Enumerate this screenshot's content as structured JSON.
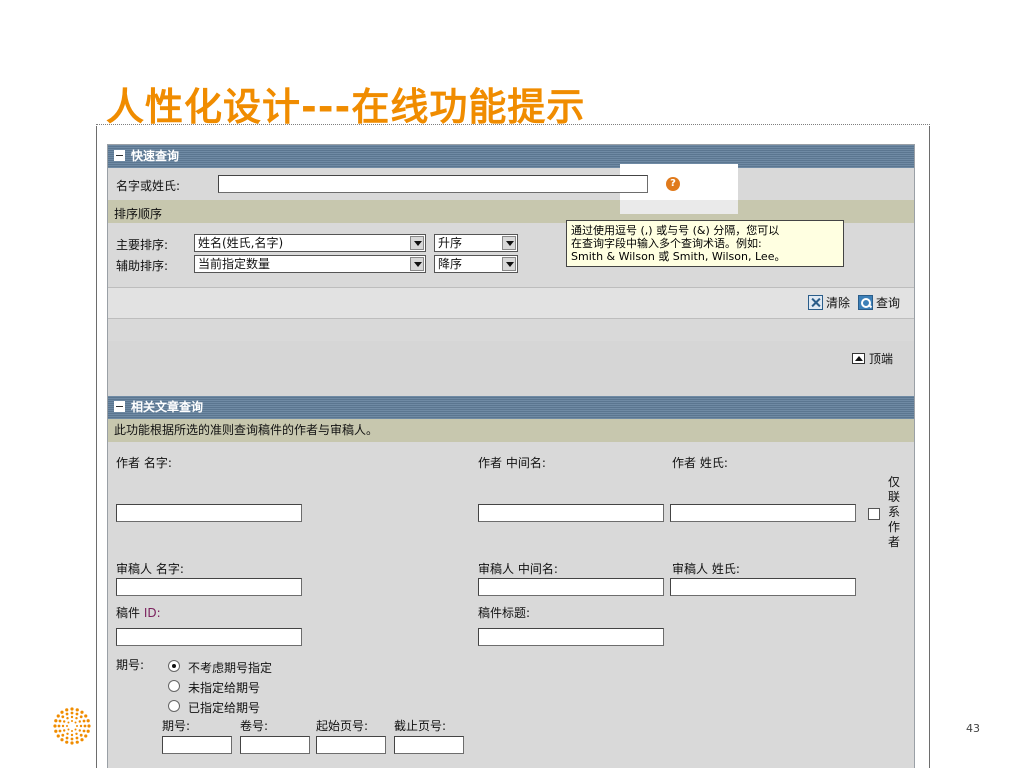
{
  "slide": {
    "title": "人性化设计---在线功能提示",
    "page_number": "43",
    "accent_color": "#f08c00"
  },
  "quick_search": {
    "header": "快速查询",
    "name_label": "名字或姓氏:",
    "name_value": "",
    "help_icon": "question-circle-icon",
    "sort_band": "排序顺序",
    "primary_sort_label": "主要排序:",
    "primary_sort_value": "姓名(姓氏,名字)",
    "primary_order_value": "升序",
    "secondary_sort_label": "辅助排序:",
    "secondary_sort_value": "当前指定数量",
    "secondary_order_value": "降序",
    "tooltip": [
      "通过使用逗号 (,) 或与号 (&) 分隔，您可以",
      "在查询字段中输入多个查询术语。例如:",
      "Smith & Wilson 或 Smith, Wilson, Lee。"
    ],
    "clear_label": "清除",
    "search_label": "查询",
    "top_label": "顶端"
  },
  "related_search": {
    "header": "相关文章查询",
    "description": "此功能根据所选的准则查询稿件的作者与审稿人。",
    "author_first": "作者 名字:",
    "author_middle": "作者 中间名:",
    "author_last": "作者 姓氏:",
    "contact_only_chars": [
      "仅",
      "联",
      "系",
      "作",
      "者"
    ],
    "reviewer_first": "审稿人 名字:",
    "reviewer_middle": "审稿人 中间名:",
    "reviewer_last": "审稿人 姓氏:",
    "manuscript_id_prefix": "稿件 ",
    "manuscript_id_suffix": "ID:",
    "manuscript_title": "稿件标题:",
    "issue_label": "期号:",
    "issue_options": [
      "不考虑期号指定",
      "未指定给期号",
      "已指定给期号"
    ],
    "issue_selected": "不考虑期号指定",
    "sub_issue": "期号:",
    "sub_volume": "卷号:",
    "sub_start_page": "起始页号:",
    "sub_end_page": "截止页号:"
  }
}
